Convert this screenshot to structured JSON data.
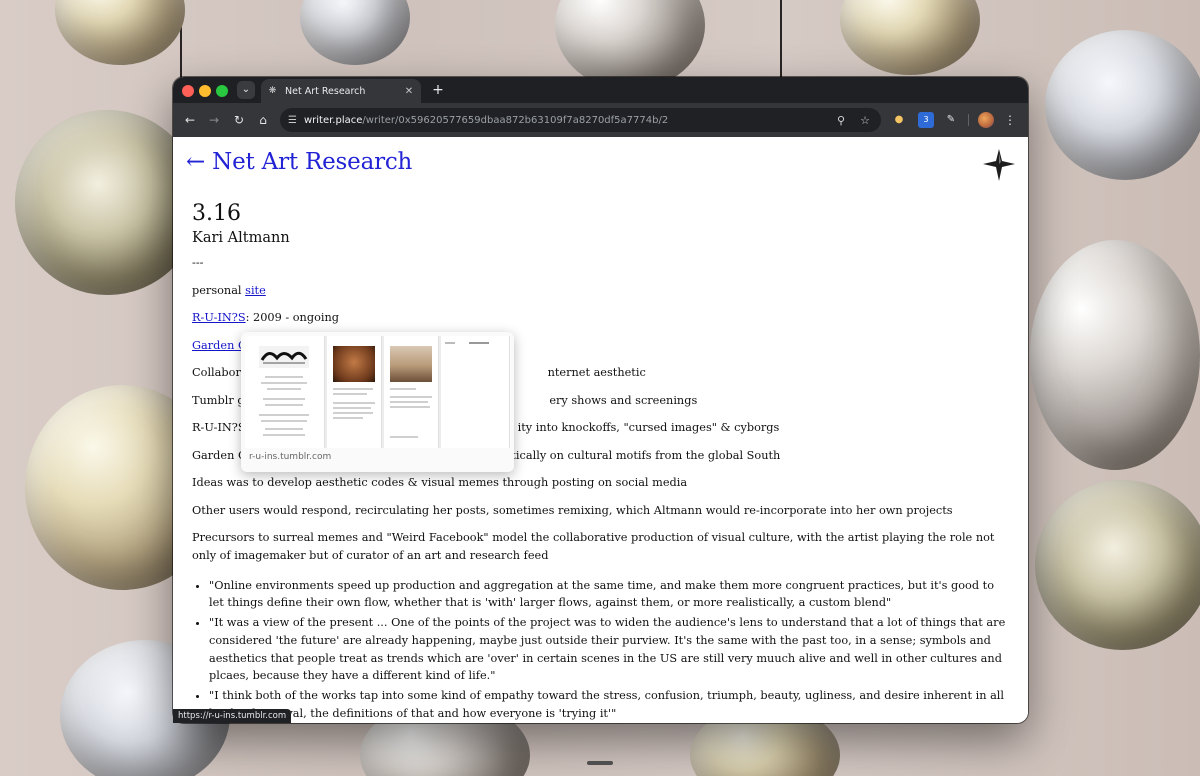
{
  "browser": {
    "tab_title": "Net Art Research",
    "url_host": "writer.place",
    "url_path": "/writer/0x59620577659dbaa872b63109f7a8270df5a7774b/2",
    "status_url": "https://r-u-ins.tumblr.com",
    "extension_badge": "3"
  },
  "icons": {
    "tab_menu": "chevron-down-icon",
    "favicon": "writer-favicon-icon",
    "tab_close": "close-icon",
    "new_tab": "plus-icon",
    "back": "arrow-left-icon",
    "forward": "arrow-right-icon",
    "reload": "reload-icon",
    "home": "home-icon",
    "site_settings": "tune-icon",
    "zoom": "magnifier-icon",
    "bookmark": "star-icon",
    "extensions": "puzzle-icon",
    "menu": "kebab-icon"
  },
  "page": {
    "back_label": "← Net Art Research",
    "heading": "3.16",
    "author": "Kari Altmann",
    "divider": "---",
    "personal_prefix": "personal ",
    "personal_link": "site",
    "runis_link": "R-U-IN?S",
    "runis_suffix": ": 2009 - ongoing",
    "garden_link": "Garden C",
    "line_collab_start": "Collabora",
    "line_collab_end": "nternet aesthetic",
    "line_tumblr_start": "Tumblr ga",
    "line_tumblr_end": "ery shows and screenings",
    "line_runis_start": "R-U-IN?S",
    "line_runis_end": "ity into knockoffs, \"cursed images\" & cyborgs",
    "line_garden_start": "Garden C",
    "line_garden_end": "stically on cultural motifs from the global South",
    "para_ideas": "Ideas was to develop aesthetic codes & visual memes through posting on social media",
    "para_users": "Other users would respond, recirculating her posts, sometimes remixing, which Altmann would re-incorporate into her own projects",
    "para_precursors": "Precursors to surreal memes and \"Weird Facebook\" model the collaborative production of visual culture, with the artist playing the role not only of imagemaker but of curator of an art and research feed",
    "quotes": [
      "\"Online environments speed up production and aggregation at the same time, and make them more congruent practices, but it's good to let things define their own flow, whether that is 'with' larger flows, against them, or more realistically, a custom blend\"",
      "\"It was a view of the present ... One of the points of the project was to widen the audience's lens to understand that a lot of things that are considered 'the future' are already happening, maybe just outside their purview. It's the same with the past too, in a sense; symbols and aesthetics that people treat as trends which are 'over' in certain scenes in the US are still very muuch alive and well in other cultures and plcaes, because they have a different kind of life.\"",
      "\"I think both of the works tap into some kind of empathy toward the stress, confusion, triumph, beauty, ugliness, and desire inherent in all kinds of survival, the definitions of that and how everyone is 'trying it'\""
    ]
  },
  "preview": {
    "url": "r-u-ins.tumblr.com"
  }
}
